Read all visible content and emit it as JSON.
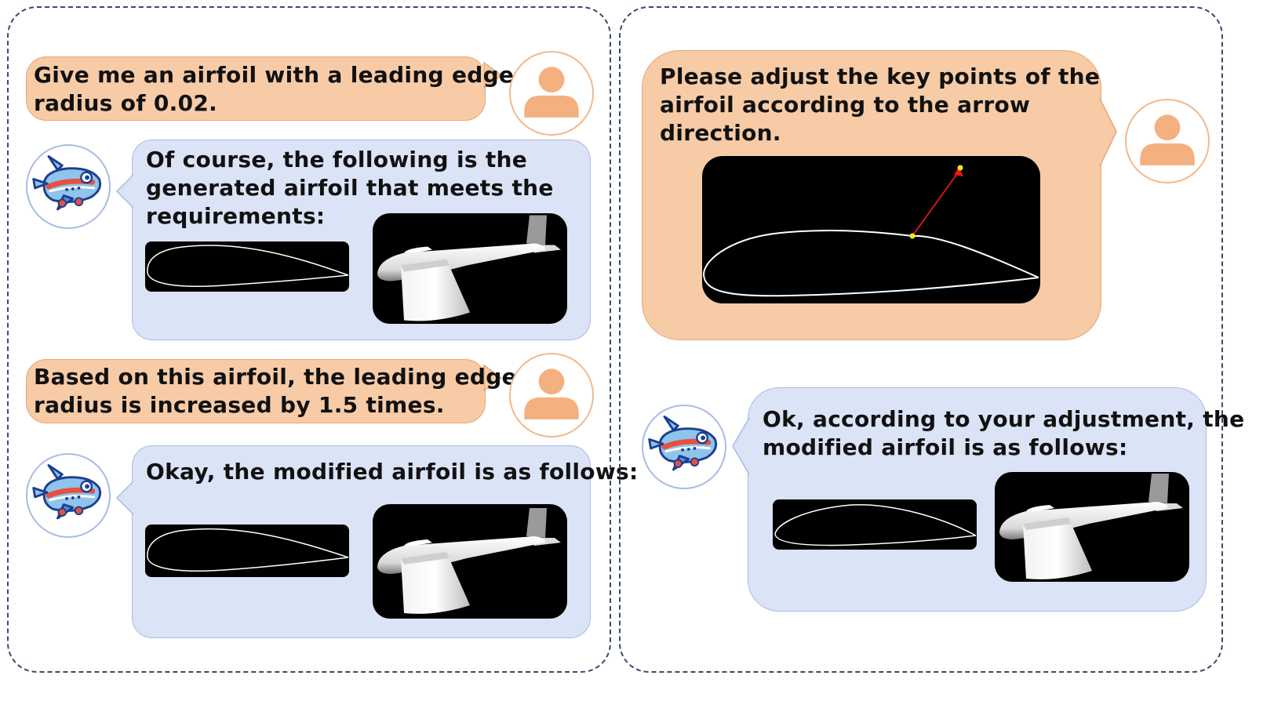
{
  "left_panel": {
    "messages": [
      {
        "role": "user",
        "text": "Give me an airfoil with a leading edge\nradius of 0.02."
      },
      {
        "role": "assistant",
        "text": "Of course, the following is the\ngenerated airfoil that meets the\nrequirements:"
      },
      {
        "role": "user",
        "text": "Based on this airfoil, the leading edge\nradius is increased by 1.5 times."
      },
      {
        "role": "assistant",
        "text": "Okay, the modified airfoil is as follows:"
      }
    ]
  },
  "right_panel": {
    "messages": [
      {
        "role": "user",
        "text": "Please adjust the key points of the\nairfoil according to the arrow\ndirection."
      },
      {
        "role": "assistant",
        "text": "Ok, according to your adjustment, the\nmodified airfoil is as follows:"
      }
    ]
  },
  "icons": {
    "user_avatar": "person-icon",
    "assistant_avatar": "cartoon-airplane-icon"
  },
  "colors": {
    "user_bubble": "#f6cba6",
    "user_border": "#eaa577",
    "assistant_bubble": "#dbe3f6",
    "assistant_border": "#a9bbe4",
    "panel_border": "#3b4a6b",
    "arrow": "#e8171b",
    "key_point": "#f5e716"
  }
}
